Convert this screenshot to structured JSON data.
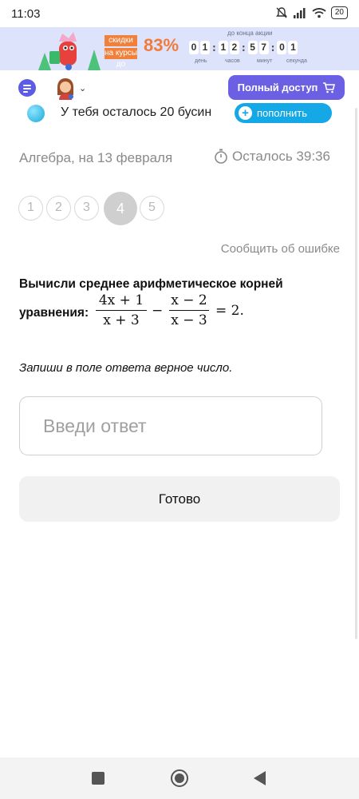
{
  "status_bar": {
    "time": "11:03",
    "battery": "20"
  },
  "promo": {
    "tag_line1": "скидки",
    "tag_line2": "на курсы до",
    "percent": "83%",
    "countdown_title": "до конца акции",
    "digits": [
      "0",
      "1",
      "1",
      "2",
      "5",
      "7",
      "0",
      "1"
    ],
    "units": [
      "день",
      "часов",
      "минут",
      "секунда"
    ]
  },
  "header": {
    "full_access_label": "Полный доступ"
  },
  "beads": {
    "text": "У тебя осталось 20 бусин",
    "topup_label": "пополнить"
  },
  "meta": {
    "subject": "Алгебра, на 13 февраля",
    "timer": "Осталось 39:36"
  },
  "questions": {
    "items": [
      "1",
      "2",
      "3",
      "4",
      "5"
    ],
    "active": "4"
  },
  "report_label": "Сообщить об ошибке",
  "task": {
    "line1": "Вычисли среднее арифметическое корней",
    "line2": "уравнения:",
    "frac1_num": "4x + 1",
    "frac1_den": "x + 3",
    "minus": "−",
    "frac2_num": "x − 2",
    "frac2_den": "x − 3",
    "rhs": "= 2."
  },
  "hint": "Запиши в поле ответа верное число.",
  "answer": {
    "placeholder": "Введи ответ",
    "value": ""
  },
  "done_label": "Готово"
}
